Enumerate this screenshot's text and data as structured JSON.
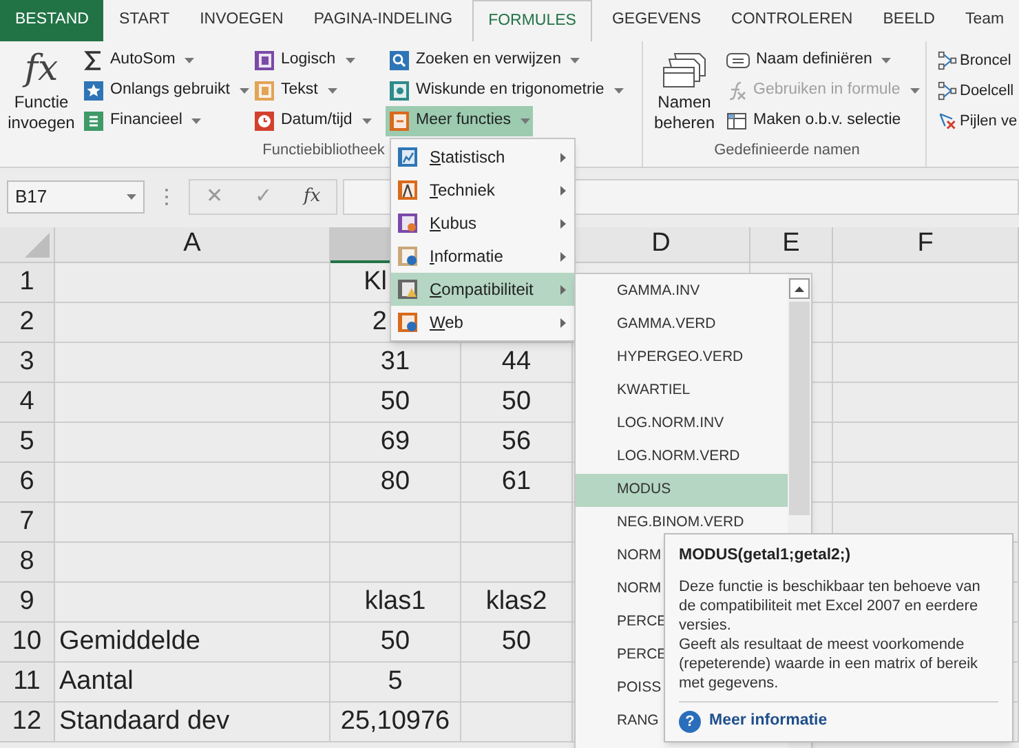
{
  "ribbon_tabs": [
    {
      "label": "BESTAND",
      "kind": "file",
      "selected": false
    },
    {
      "label": "START",
      "kind": "tab",
      "selected": false
    },
    {
      "label": "INVOEGEN",
      "kind": "tab",
      "selected": false
    },
    {
      "label": "PAGINA-INDELING",
      "kind": "tab",
      "selected": false
    },
    {
      "label": "FORMULES",
      "kind": "tab",
      "selected": true
    },
    {
      "label": "GEGEVENS",
      "kind": "tab",
      "selected": false
    },
    {
      "label": "CONTROLEREN",
      "kind": "tab",
      "selected": false
    },
    {
      "label": "BEELD",
      "kind": "tab",
      "selected": false
    },
    {
      "label": "Team",
      "kind": "tab",
      "selected": false
    }
  ],
  "ribbon_groups": [
    {
      "label": "Functiebibliotheek",
      "large_button": {
        "icon_text": "fx",
        "label": "Functie invoegen"
      },
      "columns": [
        [
          {
            "label": "AutoSom",
            "dropdown": true,
            "disabled": false,
            "open": false
          },
          {
            "label": "Onlangs gebruikt",
            "dropdown": true,
            "disabled": false,
            "open": false
          },
          {
            "label": "Financieel",
            "dropdown": true,
            "disabled": false,
            "open": false
          }
        ],
        [
          {
            "label": "Logisch",
            "dropdown": true,
            "disabled": false,
            "open": false
          },
          {
            "label": "Tekst",
            "dropdown": true,
            "disabled": false,
            "open": false
          },
          {
            "label": "Datum/tijd",
            "dropdown": true,
            "disabled": false,
            "open": false
          }
        ],
        [
          {
            "label": "Zoeken en verwijzen",
            "dropdown": true,
            "disabled": false,
            "open": false
          },
          {
            "label": "Wiskunde en trigonometrie",
            "dropdown": true,
            "disabled": false,
            "open": false
          },
          {
            "label": "Meer functies",
            "dropdown": true,
            "disabled": false,
            "open": true
          }
        ]
      ]
    },
    {
      "label": "Gedefinieerde namen",
      "large_button": {
        "label": "Namen beheren"
      },
      "columns": [
        [
          {
            "label": "Naam definiëren",
            "dropdown": true,
            "disabled": false,
            "open": false
          },
          {
            "label": "Gebruiken in formule",
            "dropdown": true,
            "disabled": true,
            "open": false
          },
          {
            "label": "Maken o.b.v. selectie",
            "dropdown": false,
            "disabled": false,
            "open": false
          }
        ]
      ]
    },
    {
      "columns": [
        [
          {
            "label": "Broncel",
            "disabled": false,
            "open": false
          },
          {
            "label": "Doelcell",
            "disabled": false,
            "open": false
          },
          {
            "label": "Pijlen ve",
            "disabled": false,
            "open": false
          }
        ]
      ]
    }
  ],
  "formula_bar": {
    "name_box": "B17",
    "cancel": "✕",
    "enter": "✓",
    "insert_function": "fx"
  },
  "sheet": {
    "columns": [
      {
        "label": "A",
        "selected": false
      },
      {
        "selected": true
      },
      null,
      {
        "label": "D",
        "selected": false
      },
      {
        "label": "E",
        "selected": false
      },
      {
        "label": "F",
        "selected": false
      }
    ],
    "rows": [
      {
        "number": "1",
        "cells": [
          null,
          "Kl"
        ]
      },
      {
        "number": "2",
        "cells": [
          null,
          "2"
        ]
      },
      {
        "number": "3",
        "cells": [
          null,
          "31",
          "44"
        ]
      },
      {
        "number": "4",
        "cells": [
          null,
          "50",
          "50"
        ]
      },
      {
        "number": "5",
        "cells": [
          null,
          "69",
          "56"
        ]
      },
      {
        "number": "6",
        "cells": [
          null,
          "80",
          "61"
        ]
      },
      {
        "number": "7"
      },
      {
        "number": "8"
      },
      {
        "number": "9",
        "cells": [
          null,
          "klas1",
          "klas2"
        ]
      },
      {
        "number": "10",
        "cells": [
          "Gemiddelde",
          "50",
          "50"
        ]
      },
      {
        "number": "11",
        "cells": [
          "Aantal",
          "5"
        ]
      },
      {
        "number": "12",
        "cells": [
          "Standaard dev",
          "25,10976"
        ]
      }
    ]
  },
  "function_menu": {
    "items": [
      {
        "label": "Statistisch",
        "selected": false
      },
      {
        "label": "Techniek",
        "selected": false
      },
      {
        "label": "Kubus",
        "selected": false
      },
      {
        "label": "Informatie",
        "selected": false
      },
      {
        "label": "Compatibiliteit",
        "selected": true
      },
      {
        "label": "Web",
        "selected": false
      }
    ]
  },
  "submenu": {
    "items": [
      {
        "label": "GAMMA.INV",
        "selected": false
      },
      {
        "label": "GAMMA.VERD",
        "selected": false
      },
      {
        "label": "HYPERGEO.VERD",
        "selected": false
      },
      {
        "label": "KWARTIEL",
        "selected": false
      },
      {
        "label": "LOG.NORM.INV",
        "selected": false
      },
      {
        "label": "LOG.NORM.VERD",
        "selected": false
      },
      {
        "label": "MODUS",
        "selected": true
      },
      {
        "label": "NEG.BINOM.VERD",
        "selected": false
      },
      {
        "label": "NORM",
        "selected": false
      },
      {
        "label": "NORM",
        "selected": false
      },
      {
        "label": "PERCE",
        "selected": false
      },
      {
        "label": "PERCE",
        "selected": false
      },
      {
        "label": "POISS",
        "selected": false
      },
      {
        "label": "RANG",
        "selected": false
      }
    ]
  },
  "tooltip": {
    "title": "MODUS(getal1;getal2;)",
    "paragraphs": [
      "Deze functie is beschikbaar ten behoeve van de compatibiliteit met Excel 2007 en eerdere versies.",
      "Geeft als resultaat de meest voorkomende (repeterende) waarde in een matrix of bereik met gegevens."
    ],
    "help_glyph": "?",
    "link": "Meer informatie"
  }
}
